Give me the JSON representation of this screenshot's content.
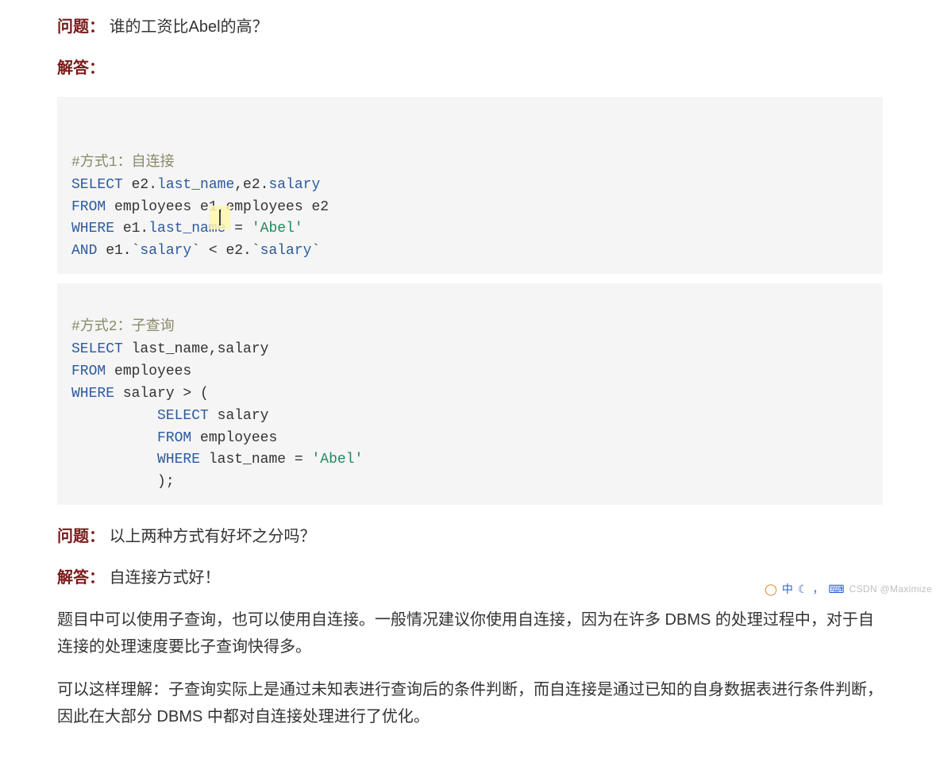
{
  "question1": {
    "label": "问题：",
    "text": "谁的工资比Abel的高？"
  },
  "answer1": {
    "label": "解答："
  },
  "code1": {
    "l1_comment": "#方式1：自连接",
    "l2": {
      "kw1": "SELECT",
      "p1": " e2.",
      "col1": "last_name",
      "p2": ",e2.",
      "col2": "salary"
    },
    "l3": {
      "kw1": "FROM",
      "p1": " employees e1,employees e2"
    },
    "l4": {
      "kw1": "WHERE",
      "p1": " e1.",
      "col1": "last_name",
      "p2": " = ",
      "str1": "'Abel'"
    },
    "l5": {
      "kw1": "AND",
      "p1": " e1.`",
      "col1": "salary",
      "p2": "` < e2.`",
      "col2": "salary",
      "p3": "`"
    }
  },
  "code2": {
    "l1_comment": "#方式2：子查询",
    "l2": {
      "kw1": "SELECT",
      "p1": " last_name,salary"
    },
    "l3": {
      "kw1": "FROM",
      "p1": " employees"
    },
    "l4": {
      "kw1": "WHERE",
      "p1": " salary > ("
    },
    "l5": {
      "sp": "          ",
      "kw1": "SELECT",
      "p1": " salary"
    },
    "l6": {
      "sp": "          ",
      "kw1": "FROM",
      "p1": " employees"
    },
    "l7": {
      "sp": "          ",
      "kw1": "WHERE",
      "p1": " last_name = ",
      "str1": "'Abel'"
    },
    "l8": {
      "sp": "          ",
      "p1": ");"
    }
  },
  "question2": {
    "label": "问题：",
    "text": "以上两种方式有好坏之分吗？"
  },
  "answer2": {
    "label": "解答：",
    "text": "自连接方式好！"
  },
  "para1": "题目中可以使用子查询，也可以使用自连接。一般情况建议你使用自连接，因为在许多 DBMS 的处理过程中，对于自连接的处理速度要比子查询快得多。",
  "para2": "可以这样理解：子查询实际上是通过未知表进行查询后的条件判断，而自连接是通过已知的自身数据表进行条件判断，因此在大部分 DBMS 中都对自连接处理进行了优化。",
  "footer": {
    "zhong": "中",
    "comma": "，",
    "watermark": "CSDN @Maximize"
  }
}
